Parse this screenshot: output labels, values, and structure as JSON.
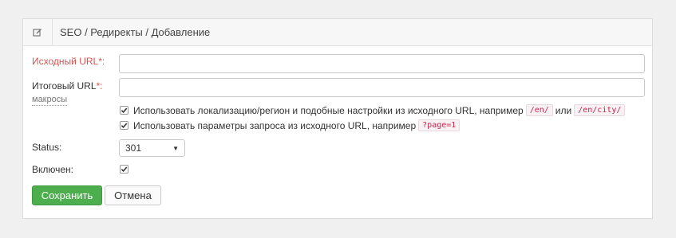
{
  "header": {
    "icon": "edit-icon",
    "title": "SEO / Редиректы / Добавление"
  },
  "form": {
    "source_url": {
      "label": "Исходный URL",
      "required_mark": "*:",
      "value": ""
    },
    "target_url": {
      "label": "Итоговый URL",
      "required_mark": "*:",
      "value": "",
      "macros_link": "макросы"
    },
    "option_locale": {
      "checked": true,
      "text": "Использовать локализацию/регион и подобные настройки из исходного URL, например",
      "code1": "/en/",
      "joiner": "или",
      "code2": "/en/city/"
    },
    "option_query": {
      "checked": true,
      "text": "Использовать параметры запроса из исходного URL, например",
      "code": "?page=1"
    },
    "status": {
      "label": "Status:",
      "value": "301"
    },
    "enabled": {
      "label": "Включен:",
      "checked": true
    }
  },
  "buttons": {
    "save": "Сохранить",
    "cancel": "Отмена"
  },
  "colors": {
    "save_button": "#4cae4c",
    "required_label": "#d9534f",
    "code_text": "#c7254e"
  }
}
